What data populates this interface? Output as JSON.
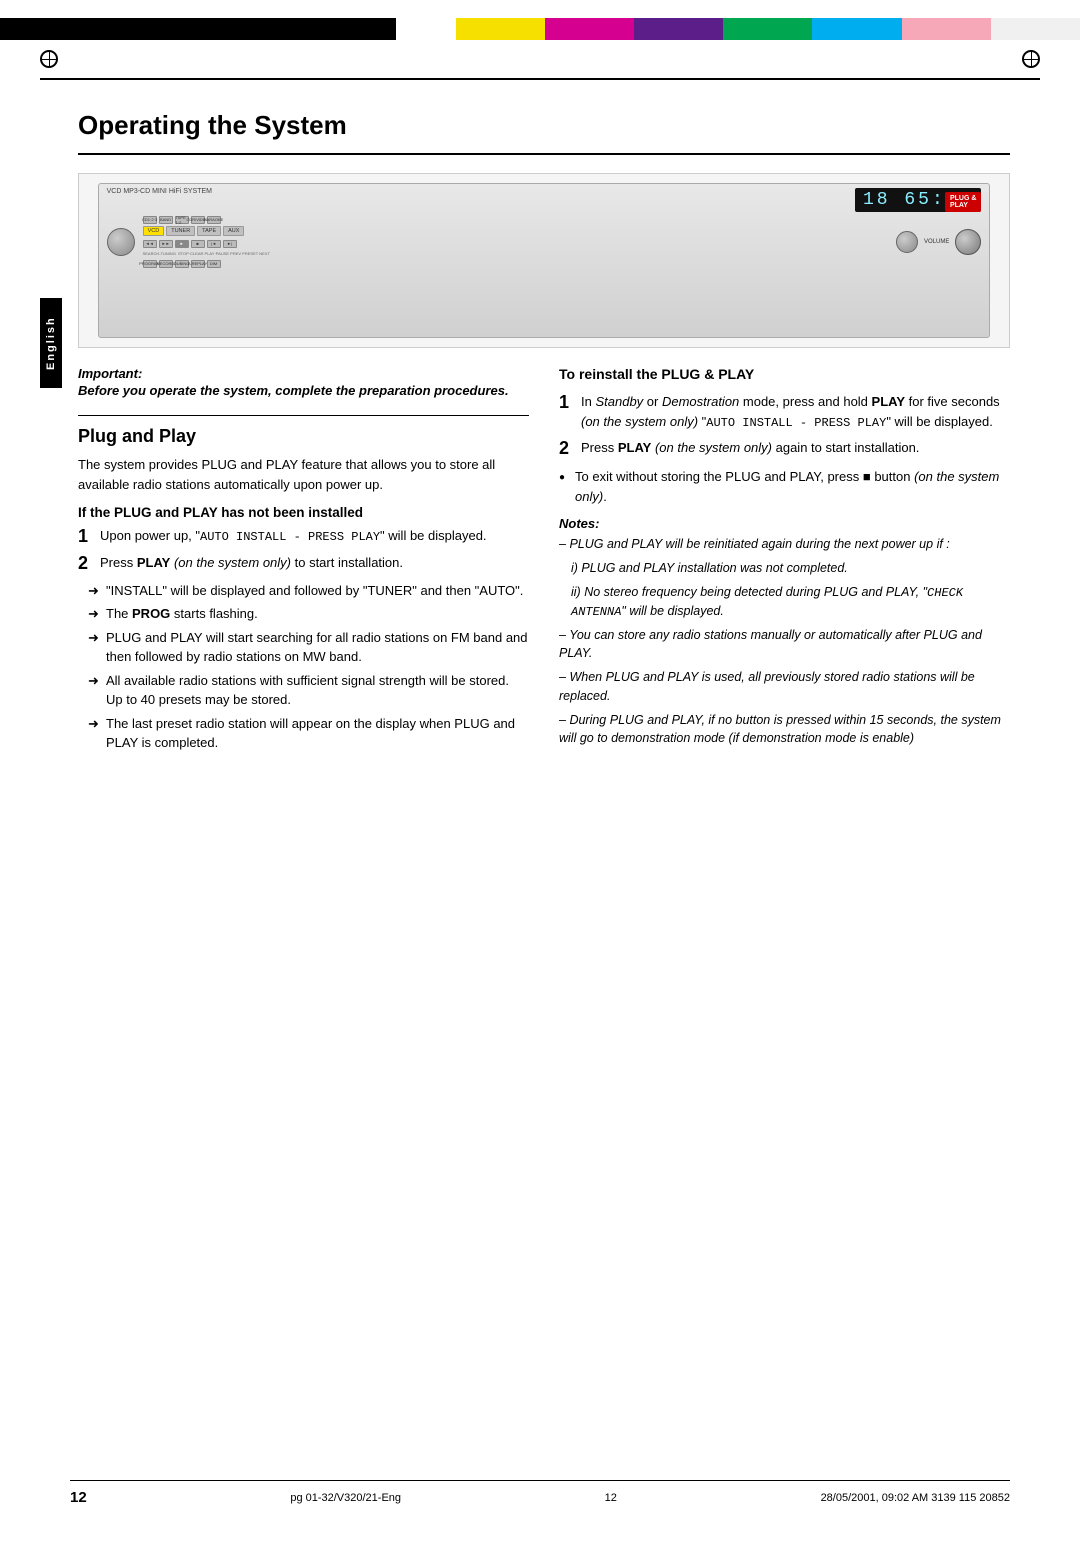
{
  "colorbar": {
    "segments": [
      "black",
      "black",
      "black",
      "black",
      "black",
      "yellow",
      "magenta",
      "purple",
      "green",
      "cyan",
      "pink",
      "white"
    ]
  },
  "page": {
    "title": "Operating the System",
    "sidebar_label": "English",
    "page_number": "12",
    "footer_left": "pg 01-32/V320/21-Eng",
    "footer_center": "12",
    "footer_right": "28/05/2001, 09:02 AM",
    "footer_catalog": "3139 115 20852"
  },
  "device": {
    "display_text": "18  65:29",
    "brand": "VCD MP3-CD MINI HiFi SYSTEM",
    "plug_play_label": "PLUG &\nPLAY"
  },
  "important": {
    "label": "Important:",
    "text": "Before you operate the system, complete the preparation procedures."
  },
  "plug_and_play": {
    "heading": "Plug and Play",
    "intro": "The system provides PLUG and PLAY feature that allows you to store all available radio stations automatically upon power up.",
    "if_not_installed_heading": "If the PLUG and PLAY has not been installed",
    "steps": [
      {
        "num": "1",
        "text_before": "Upon power up, \"",
        "mono": "AUTO INSTALL - PRESS PLAY",
        "text_after": "\" will be displayed."
      },
      {
        "num": "2",
        "text_before": "Press ",
        "bold": "PLAY",
        "text_after": " (on the system only) to start installation."
      }
    ],
    "arrows": [
      "\"INSTALL\" will be displayed and followed by \"TUNER\" and then \"AUTO\".",
      "The PROG starts flashing.",
      "PLUG and PLAY will start searching for all radio stations on FM band and then followed by radio stations on MW band.",
      "All available radio stations with sufficient signal strength will be stored. Up to 40 presets may be stored.",
      "The last preset radio station will appear on the display when PLUG and PLAY is completed."
    ]
  },
  "reinstall": {
    "heading": "To reinstall the PLUG & PLAY",
    "steps": [
      {
        "num": "1",
        "text": "In Standby or Demostration mode, press and hold PLAY for five seconds (on the system only) \"AUTO INSTALL - PRESS PLAY\" will be displayed."
      },
      {
        "num": "2",
        "text": "Press PLAY (on the system only) again to start installation."
      }
    ],
    "bullet": "To exit without storing the PLUG and PLAY, press ■ button (on the system only).",
    "notes_heading": "Notes:",
    "notes": [
      "– PLUG and PLAY will be reinitiated again during the next power up if :",
      "i) PLUG and PLAY installation was not completed.",
      "ii) No stereo frequency being detected during PLUG and PLAY, \"CHECK ANTENNA\" will be displayed.",
      "– You can store any radio stations manually or automatically after PLUG and PLAY.",
      "– When PLUG and PLAY is used, all previously stored radio stations will be replaced.",
      "– During PLUG and PLAY, if no button is pressed within 15 seconds, the system will go to demonstration mode (if demonstration mode is enable)"
    ]
  }
}
